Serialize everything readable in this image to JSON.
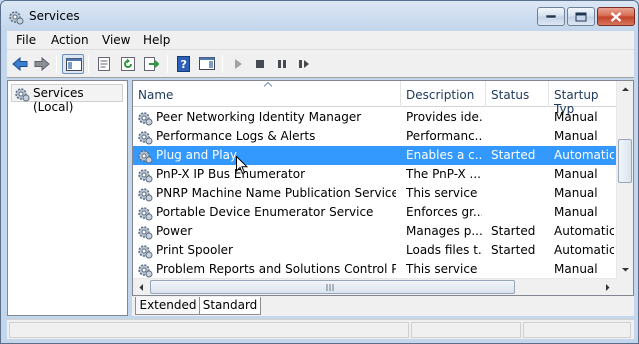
{
  "window": {
    "title": "Services"
  },
  "menu": [
    "File",
    "Action",
    "View",
    "Help"
  ],
  "toolbar": {
    "buttons": [
      "back-icon",
      "forward-icon",
      "show-hide-tree-icon",
      "properties-icon",
      "refresh-icon",
      "export-list-icon",
      "help-icon",
      "show-hide-action-pane-icon",
      "start-service-icon",
      "stop-service-icon",
      "pause-service-icon",
      "restart-service-icon"
    ]
  },
  "tree": {
    "item": "Services (Local)"
  },
  "columns": {
    "name": "Name",
    "description": "Description",
    "status": "Status",
    "startup": "Startup Typ"
  },
  "rows": [
    {
      "name": "Peer Networking Identity Manager",
      "description": "Provides ide...",
      "status": "",
      "startup": "Manual"
    },
    {
      "name": "Performance Logs & Alerts",
      "description": "Performanc...",
      "status": "",
      "startup": "Manual"
    },
    {
      "name": "Plug and Play",
      "description": "Enables a c...",
      "status": "Started",
      "startup": "Automatic"
    },
    {
      "name": "PnP-X IP Bus Enumerator",
      "description": "The PnP-X ...",
      "status": "",
      "startup": "Manual"
    },
    {
      "name": "PNRP Machine Name Publication Service",
      "description": "This service ...",
      "status": "",
      "startup": "Manual"
    },
    {
      "name": "Portable Device Enumerator Service",
      "description": "Enforces gr...",
      "status": "",
      "startup": "Manual"
    },
    {
      "name": "Power",
      "description": "Manages p...",
      "status": "Started",
      "startup": "Automatic"
    },
    {
      "name": "Print Spooler",
      "description": "Loads files t...",
      "status": "Started",
      "startup": "Automatic"
    },
    {
      "name": "Problem Reports and Solutions Control Pan...",
      "description": "This service ...",
      "status": "",
      "startup": "Manual"
    }
  ],
  "selected_row_index": 2,
  "tabs": {
    "extended": "Extended",
    "standard": "Standard",
    "active": "Standard"
  },
  "colors": {
    "selection": "#3399ff",
    "title_bg": "#c4d6ec",
    "close_button": "#c24128"
  }
}
